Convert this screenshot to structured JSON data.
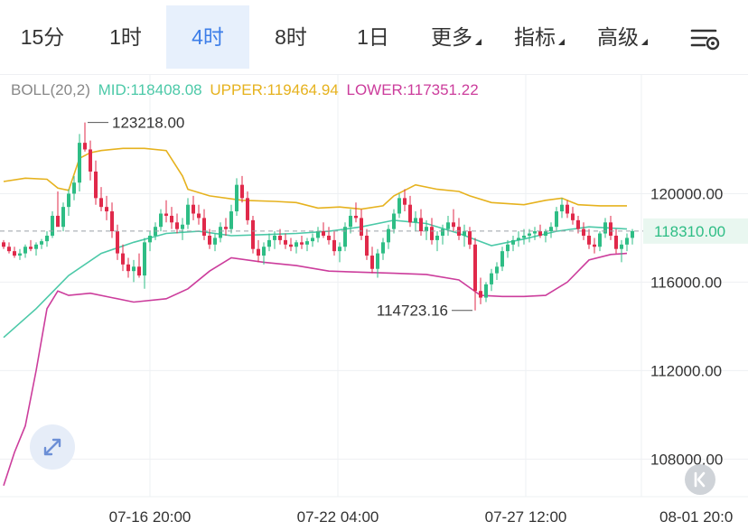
{
  "tabs": [
    {
      "label": "15分",
      "active": false,
      "dropdown": false
    },
    {
      "label": "1时",
      "active": false,
      "dropdown": false
    },
    {
      "label": "4时",
      "active": true,
      "dropdown": false
    },
    {
      "label": "8时",
      "active": false,
      "dropdown": false
    },
    {
      "label": "1日",
      "active": false,
      "dropdown": false
    },
    {
      "label": "更多",
      "active": false,
      "dropdown": true
    },
    {
      "label": "指标",
      "active": false,
      "dropdown": true
    },
    {
      "label": "高级",
      "active": false,
      "dropdown": true
    }
  ],
  "icons": {
    "settings": "settings-sliders-icon",
    "expand": "expand-icon",
    "jump": "jump-to-latest-icon"
  },
  "legend": {
    "name": "BOLL(20,2)",
    "mid": "MID:118408.08",
    "upper": "UPPER:119464.94",
    "lower": "LOWER:117351.22"
  },
  "colors": {
    "up": "#2ebd85",
    "down": "#e0294a",
    "mid": "#4cc9a8",
    "upper": "#e6b21e",
    "lower": "#cc3d9c",
    "active_tab": "#3d7ee8",
    "current_price_bg": "#e9f7f0",
    "current_price_text": "#2ebd85"
  },
  "chart_data": {
    "type": "candlestick",
    "y_ticks": [
      "120000.00",
      "116000.00",
      "112000.00",
      "108000.00"
    ],
    "y_tick_values": [
      120000,
      116000,
      112000,
      108000
    ],
    "x_ticks": [
      "07-16 20:00",
      "07-22 04:00",
      "07-27 12:00",
      "08-01 20:0"
    ],
    "current_price": {
      "label": "118310.00",
      "value": 118310
    },
    "high_annotation": {
      "label": "123218.00",
      "value": 123218
    },
    "low_annotation": {
      "label": "114723.16",
      "value": 114723.16
    },
    "ylim": [
      106300,
      125000
    ],
    "candles": [
      [
        117800,
        117900,
        117500,
        117600
      ],
      [
        117600,
        117800,
        117300,
        117400
      ],
      [
        117400,
        117600,
        117100,
        117200
      ],
      [
        117200,
        117500,
        117000,
        117300
      ],
      [
        117300,
        117700,
        117100,
        117600
      ],
      [
        117600,
        117900,
        117400,
        117500
      ],
      [
        117500,
        117800,
        117200,
        117700
      ],
      [
        117700,
        117950,
        117500,
        117850
      ],
      [
        117850,
        118300,
        117600,
        118100
      ],
      [
        118100,
        119200,
        118000,
        119000
      ],
      [
        119000,
        120100,
        118600,
        118500
      ],
      [
        118500,
        119600,
        118300,
        119400
      ],
      [
        119400,
        120200,
        119000,
        120000
      ],
      [
        120000,
        120800,
        119700,
        120500
      ],
      [
        120500,
        122700,
        120100,
        122300
      ],
      [
        122300,
        123218,
        121900,
        122000
      ],
      [
        122000,
        122400,
        120600,
        121000
      ],
      [
        121000,
        121500,
        119500,
        119800
      ],
      [
        119800,
        120300,
        119200,
        119400
      ],
      [
        119400,
        119900,
        118800,
        119200
      ],
      [
        119200,
        119600,
        118000,
        118300
      ],
      [
        118300,
        118600,
        117000,
        117300
      ],
      [
        117300,
        117700,
        116500,
        116800
      ],
      [
        116800,
        117100,
        116200,
        116500
      ],
      [
        116500,
        117000,
        116000,
        116700
      ],
      [
        116700,
        117300,
        116200,
        116300
      ],
      [
        116300,
        118000,
        115700,
        117800
      ],
      [
        117800,
        118300,
        117400,
        118100
      ],
      [
        118100,
        118700,
        117900,
        118500
      ],
      [
        118500,
        119300,
        118300,
        119100
      ],
      [
        119100,
        119700,
        118700,
        119000
      ],
      [
        119000,
        119400,
        118400,
        118700
      ],
      [
        118700,
        119100,
        118200,
        118400
      ],
      [
        118400,
        118900,
        117900,
        118600
      ],
      [
        118600,
        119800,
        118400,
        119500
      ],
      [
        119500,
        119900,
        118800,
        119100
      ],
      [
        119100,
        119500,
        118600,
        118900
      ],
      [
        118900,
        119300,
        117900,
        118100
      ],
      [
        118100,
        118400,
        117500,
        117700
      ],
      [
        117700,
        118200,
        117400,
        118000
      ],
      [
        118000,
        118700,
        117800,
        118500
      ],
      [
        118500,
        118900,
        118100,
        118400
      ],
      [
        118400,
        119500,
        118200,
        119200
      ],
      [
        119200,
        120700,
        119000,
        120400
      ],
      [
        120400,
        120800,
        119600,
        119800
      ],
      [
        119800,
        120100,
        118600,
        118800
      ],
      [
        118800,
        119000,
        117300,
        117500
      ],
      [
        117500,
        117900,
        116900,
        117200
      ],
      [
        117200,
        117800,
        116800,
        117600
      ],
      [
        117600,
        118200,
        117400,
        117900
      ],
      [
        117900,
        118300,
        117500,
        118100
      ],
      [
        118100,
        118400,
        117700,
        117900
      ],
      [
        117900,
        118200,
        117500,
        117700
      ],
      [
        117700,
        118000,
        117400,
        117600
      ],
      [
        117600,
        117900,
        117300,
        117800
      ],
      [
        117800,
        118100,
        117500,
        117700
      ],
      [
        117700,
        118000,
        117400,
        117850
      ],
      [
        117850,
        118200,
        117600,
        118000
      ],
      [
        118000,
        118500,
        117800,
        118300
      ],
      [
        118300,
        118700,
        118000,
        118100
      ],
      [
        118100,
        118500,
        117700,
        117900
      ],
      [
        117900,
        118300,
        117200,
        117400
      ],
      [
        117400,
        117800,
        116900,
        117600
      ],
      [
        117600,
        118700,
        117400,
        118500
      ],
      [
        118500,
        119300,
        118200,
        119000
      ],
      [
        119000,
        119600,
        118700,
        118900
      ],
      [
        118900,
        119300,
        117900,
        118100
      ],
      [
        118100,
        118400,
        117000,
        117200
      ],
      [
        117200,
        117600,
        116400,
        116600
      ],
      [
        116600,
        117500,
        116200,
        117300
      ],
      [
        117300,
        118000,
        117000,
        117800
      ],
      [
        117800,
        118600,
        117500,
        118400
      ],
      [
        118400,
        119300,
        118200,
        119100
      ],
      [
        119100,
        120000,
        118900,
        119800
      ],
      [
        119800,
        120200,
        119200,
        119500
      ],
      [
        119500,
        119900,
        118500,
        118700
      ],
      [
        118700,
        119200,
        118300,
        118900
      ],
      [
        118900,
        119300,
        118100,
        118300
      ],
      [
        118300,
        118800,
        117900,
        118500
      ],
      [
        118500,
        118900,
        117700,
        117900
      ],
      [
        117900,
        118300,
        117400,
        118100
      ],
      [
        118100,
        118600,
        117700,
        118400
      ],
      [
        118400,
        119000,
        118100,
        118700
      ],
      [
        118700,
        119300,
        118300,
        118500
      ],
      [
        118500,
        118900,
        117900,
        118100
      ],
      [
        118100,
        118600,
        117600,
        118300
      ],
      [
        118300,
        118500,
        117500,
        117700
      ],
      [
        117700,
        118000,
        114723.16,
        115600
      ],
      [
        115600,
        116200,
        115000,
        115300
      ],
      [
        115300,
        116000,
        115100,
        115900
      ],
      [
        115900,
        116600,
        115600,
        116400
      ],
      [
        116400,
        116900,
        116100,
        116700
      ],
      [
        116700,
        117600,
        116500,
        117400
      ],
      [
        117400,
        117900,
        117100,
        117700
      ],
      [
        117700,
        118100,
        117400,
        117900
      ],
      [
        117900,
        118300,
        117600,
        118000
      ],
      [
        118000,
        118400,
        117700,
        118100
      ],
      [
        118100,
        118400,
        117800,
        118200
      ],
      [
        118200,
        118500,
        117900,
        118300
      ],
      [
        118300,
        118600,
        118000,
        118100
      ],
      [
        118100,
        118400,
        117800,
        118300
      ],
      [
        118300,
        118700,
        118000,
        118500
      ],
      [
        118500,
        119400,
        118300,
        119200
      ],
      [
        119200,
        119800,
        118900,
        119500
      ],
      [
        119500,
        119700,
        118900,
        119100
      ],
      [
        119100,
        119400,
        118600,
        118800
      ],
      [
        118800,
        119000,
        118200,
        118400
      ],
      [
        118400,
        118700,
        117900,
        118100
      ],
      [
        118100,
        118400,
        117500,
        117700
      ],
      [
        117700,
        118000,
        117300,
        117600
      ],
      [
        117600,
        118300,
        117400,
        118200
      ],
      [
        118200,
        118900,
        118000,
        118700
      ],
      [
        118700,
        119000,
        117900,
        118100
      ],
      [
        118100,
        118400,
        117300,
        117500
      ],
      [
        117500,
        117900,
        116900,
        117700
      ],
      [
        117700,
        118200,
        117400,
        118000
      ],
      [
        118000,
        118400,
        117700,
        118310
      ]
    ],
    "mid": [
      [
        0,
        113500
      ],
      [
        6,
        114800
      ],
      [
        12,
        116300
      ],
      [
        18,
        117300
      ],
      [
        24,
        117800
      ],
      [
        30,
        118200
      ],
      [
        36,
        118300
      ],
      [
        42,
        118100
      ],
      [
        48,
        118150
      ],
      [
        54,
        118200
      ],
      [
        60,
        118300
      ],
      [
        66,
        118500
      ],
      [
        72,
        118800
      ],
      [
        78,
        118650
      ],
      [
        84,
        118200
      ],
      [
        90,
        117650
      ],
      [
        96,
        117950
      ],
      [
        102,
        118300
      ],
      [
        108,
        118500
      ],
      [
        115,
        118400
      ]
    ],
    "upper": [
      [
        0,
        120550
      ],
      [
        4,
        120700
      ],
      [
        8,
        120650
      ],
      [
        10,
        120250
      ],
      [
        12,
        120150
      ],
      [
        14,
        121600
      ],
      [
        16,
        121850
      ],
      [
        18,
        121950
      ],
      [
        22,
        122050
      ],
      [
        26,
        122050
      ],
      [
        30,
        121950
      ],
      [
        33,
        120800
      ],
      [
        34,
        120200
      ],
      [
        38,
        119900
      ],
      [
        44,
        119700
      ],
      [
        50,
        119650
      ],
      [
        54,
        119600
      ],
      [
        58,
        119350
      ],
      [
        62,
        119400
      ],
      [
        66,
        119300
      ],
      [
        70,
        119450
      ],
      [
        72,
        119900
      ],
      [
        76,
        120400
      ],
      [
        80,
        120200
      ],
      [
        84,
        120100
      ],
      [
        86,
        119900
      ],
      [
        90,
        119600
      ],
      [
        96,
        119500
      ],
      [
        100,
        119700
      ],
      [
        103,
        119800
      ],
      [
        106,
        119500
      ],
      [
        110,
        119450
      ],
      [
        115,
        119450
      ]
    ],
    "lower": [
      [
        0,
        106800
      ],
      [
        2,
        108300
      ],
      [
        4,
        109500
      ],
      [
        6,
        112000
      ],
      [
        8,
        114800
      ],
      [
        10,
        115600
      ],
      [
        12,
        115400
      ],
      [
        16,
        115500
      ],
      [
        20,
        115300
      ],
      [
        24,
        115100
      ],
      [
        30,
        115250
      ],
      [
        34,
        115700
      ],
      [
        38,
        116500
      ],
      [
        42,
        117100
      ],
      [
        48,
        116900
      ],
      [
        54,
        116750
      ],
      [
        60,
        116500
      ],
      [
        66,
        116450
      ],
      [
        72,
        116400
      ],
      [
        78,
        116350
      ],
      [
        84,
        116100
      ],
      [
        88,
        115400
      ],
      [
        92,
        115350
      ],
      [
        96,
        115350
      ],
      [
        100,
        115400
      ],
      [
        104,
        116000
      ],
      [
        108,
        117000
      ],
      [
        112,
        117250
      ],
      [
        115,
        117300
      ]
    ]
  }
}
